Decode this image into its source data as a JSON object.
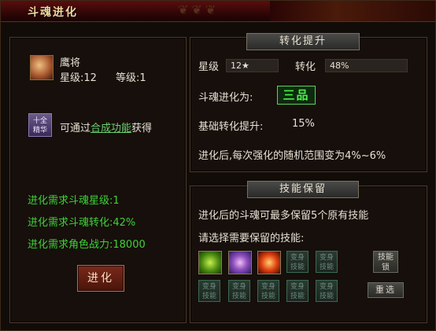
{
  "window": {
    "title": "斗魂进化"
  },
  "left": {
    "name": "鹰将",
    "star_label": "星级:12",
    "level_label": "等级:1",
    "material_icon_text": "十全\n精华",
    "source_prefix": "可通过",
    "source_link": "合成功能",
    "source_suffix": "获得",
    "req_star": "进化需求斗魂星级:1",
    "req_conv": "进化需求斗魂转化:42%",
    "req_power": "进化需求角色战力:18000",
    "evolve_button": "进化"
  },
  "conversion": {
    "header": "转化提升",
    "star_label": "星级",
    "star_value": "12★",
    "conv_label": "转化",
    "conv_value": "48%",
    "evolve_to_label": "斗魂进化为:",
    "grade": "三品",
    "base_label": "基础转化提升:",
    "base_value": "15%",
    "note": "进化后,每次强化的随机范围变为4%~6%"
  },
  "skills": {
    "header": "技能保留",
    "line1": "进化后的斗魂可最多保留5个原有技能",
    "line2": "请选择需要保留的技能:",
    "slot_label": "变身\n技能",
    "lock_button": "技能\n锁",
    "reselect_button": "重选"
  }
}
